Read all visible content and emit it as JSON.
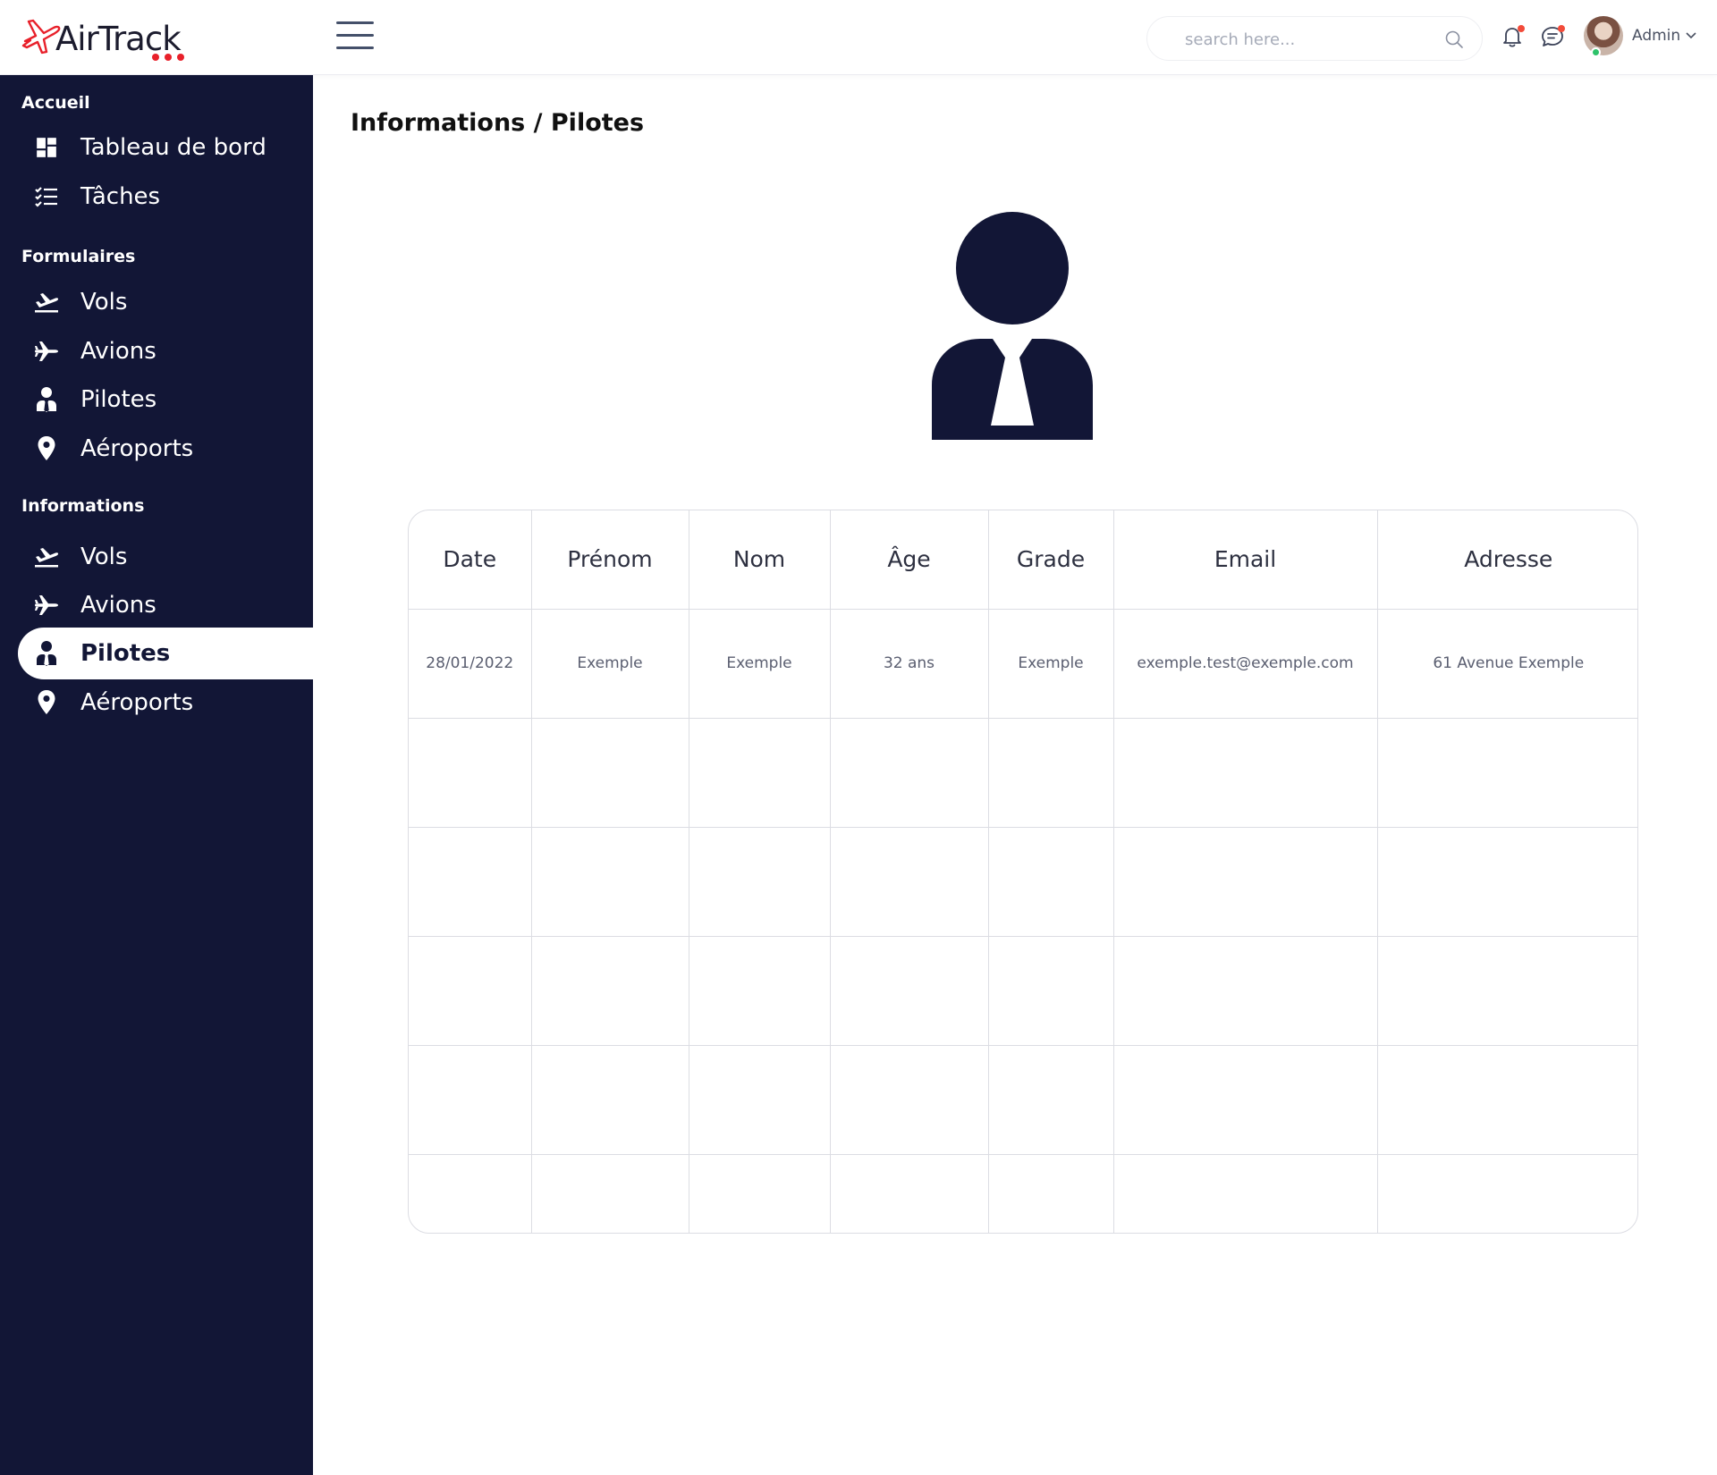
{
  "brand": {
    "name": "AirTrack",
    "accent": "#e8202a",
    "sidebar_bg": "#121636"
  },
  "header": {
    "search_placeholder": "search here...",
    "user_name": "Admin",
    "icons": [
      "menu-icon",
      "search-icon",
      "bell-icon",
      "chat-icon",
      "chevron-down-icon"
    ]
  },
  "sidebar": {
    "sections": [
      {
        "title": "Accueil",
        "items": [
          {
            "label": "Tableau de bord",
            "icon": "dashboard-icon"
          },
          {
            "label": "Tâches",
            "icon": "checklist-icon"
          }
        ]
      },
      {
        "title": "Formulaires",
        "items": [
          {
            "label": "Vols",
            "icon": "departure-icon"
          },
          {
            "label": "Avions",
            "icon": "plane-icon"
          },
          {
            "label": "Pilotes",
            "icon": "pilot-icon"
          },
          {
            "label": "Aéroports",
            "icon": "location-pin-icon"
          }
        ]
      },
      {
        "title": "Informations",
        "items": [
          {
            "label": "Vols",
            "icon": "departure-icon"
          },
          {
            "label": "Avions",
            "icon": "plane-icon"
          },
          {
            "label": "Pilotes",
            "icon": "pilot-icon",
            "active": true
          },
          {
            "label": "Aéroports",
            "icon": "location-pin-icon"
          }
        ]
      }
    ]
  },
  "main": {
    "breadcrumb": "Informations / Pilotes",
    "figure_icon": "pilot-icon",
    "table": {
      "columns": [
        "Date",
        "Prénom",
        "Nom",
        "Âge",
        "Grade",
        "Email",
        "Adresse"
      ],
      "rows": [
        [
          "28/01/2022",
          "Exemple",
          "Exemple",
          "32 ans",
          "Exemple",
          "exemple.test@exemple.com",
          "61 Avenue Exemple"
        ]
      ]
    }
  }
}
